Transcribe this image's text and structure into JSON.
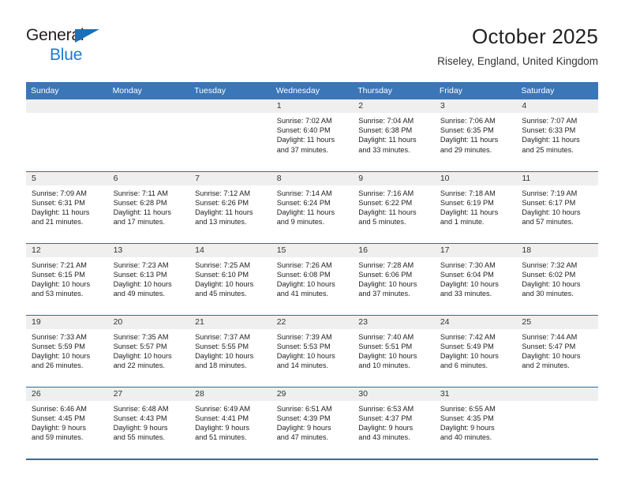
{
  "brand": {
    "line1": "General",
    "line2": "Blue",
    "triangle_color": "#1b70b8",
    "blue_text_color": "#1b7ad1"
  },
  "header": {
    "title": "October 2025",
    "subtitle": "Riseley, England, United Kingdom"
  },
  "theme": {
    "header_bg": "#3a76b8",
    "rule_color": "#2b6cab",
    "daynum_bg": "#efefef"
  },
  "weekday_headers": [
    "Sunday",
    "Monday",
    "Tuesday",
    "Wednesday",
    "Thursday",
    "Friday",
    "Saturday"
  ],
  "weeks": [
    [
      {
        "day": "",
        "empty": true,
        "sunrise": "",
        "sunset": "",
        "daylight_line1": "",
        "daylight_line2": ""
      },
      {
        "day": "",
        "empty": true,
        "sunrise": "",
        "sunset": "",
        "daylight_line1": "",
        "daylight_line2": ""
      },
      {
        "day": "",
        "empty": true,
        "sunrise": "",
        "sunset": "",
        "daylight_line1": "",
        "daylight_line2": ""
      },
      {
        "day": "1",
        "empty": false,
        "sunrise": "Sunrise: 7:02 AM",
        "sunset": "Sunset: 6:40 PM",
        "daylight_line1": "Daylight: 11 hours",
        "daylight_line2": "and 37 minutes."
      },
      {
        "day": "2",
        "empty": false,
        "sunrise": "Sunrise: 7:04 AM",
        "sunset": "Sunset: 6:38 PM",
        "daylight_line1": "Daylight: 11 hours",
        "daylight_line2": "and 33 minutes."
      },
      {
        "day": "3",
        "empty": false,
        "sunrise": "Sunrise: 7:06 AM",
        "sunset": "Sunset: 6:35 PM",
        "daylight_line1": "Daylight: 11 hours",
        "daylight_line2": "and 29 minutes."
      },
      {
        "day": "4",
        "empty": false,
        "sunrise": "Sunrise: 7:07 AM",
        "sunset": "Sunset: 6:33 PM",
        "daylight_line1": "Daylight: 11 hours",
        "daylight_line2": "and 25 minutes."
      }
    ],
    [
      {
        "day": "5",
        "empty": false,
        "sunrise": "Sunrise: 7:09 AM",
        "sunset": "Sunset: 6:31 PM",
        "daylight_line1": "Daylight: 11 hours",
        "daylight_line2": "and 21 minutes."
      },
      {
        "day": "6",
        "empty": false,
        "sunrise": "Sunrise: 7:11 AM",
        "sunset": "Sunset: 6:28 PM",
        "daylight_line1": "Daylight: 11 hours",
        "daylight_line2": "and 17 minutes."
      },
      {
        "day": "7",
        "empty": false,
        "sunrise": "Sunrise: 7:12 AM",
        "sunset": "Sunset: 6:26 PM",
        "daylight_line1": "Daylight: 11 hours",
        "daylight_line2": "and 13 minutes."
      },
      {
        "day": "8",
        "empty": false,
        "sunrise": "Sunrise: 7:14 AM",
        "sunset": "Sunset: 6:24 PM",
        "daylight_line1": "Daylight: 11 hours",
        "daylight_line2": "and 9 minutes."
      },
      {
        "day": "9",
        "empty": false,
        "sunrise": "Sunrise: 7:16 AM",
        "sunset": "Sunset: 6:22 PM",
        "daylight_line1": "Daylight: 11 hours",
        "daylight_line2": "and 5 minutes."
      },
      {
        "day": "10",
        "empty": false,
        "sunrise": "Sunrise: 7:18 AM",
        "sunset": "Sunset: 6:19 PM",
        "daylight_line1": "Daylight: 11 hours",
        "daylight_line2": "and 1 minute."
      },
      {
        "day": "11",
        "empty": false,
        "sunrise": "Sunrise: 7:19 AM",
        "sunset": "Sunset: 6:17 PM",
        "daylight_line1": "Daylight: 10 hours",
        "daylight_line2": "and 57 minutes."
      }
    ],
    [
      {
        "day": "12",
        "empty": false,
        "sunrise": "Sunrise: 7:21 AM",
        "sunset": "Sunset: 6:15 PM",
        "daylight_line1": "Daylight: 10 hours",
        "daylight_line2": "and 53 minutes."
      },
      {
        "day": "13",
        "empty": false,
        "sunrise": "Sunrise: 7:23 AM",
        "sunset": "Sunset: 6:13 PM",
        "daylight_line1": "Daylight: 10 hours",
        "daylight_line2": "and 49 minutes."
      },
      {
        "day": "14",
        "empty": false,
        "sunrise": "Sunrise: 7:25 AM",
        "sunset": "Sunset: 6:10 PM",
        "daylight_line1": "Daylight: 10 hours",
        "daylight_line2": "and 45 minutes."
      },
      {
        "day": "15",
        "empty": false,
        "sunrise": "Sunrise: 7:26 AM",
        "sunset": "Sunset: 6:08 PM",
        "daylight_line1": "Daylight: 10 hours",
        "daylight_line2": "and 41 minutes."
      },
      {
        "day": "16",
        "empty": false,
        "sunrise": "Sunrise: 7:28 AM",
        "sunset": "Sunset: 6:06 PM",
        "daylight_line1": "Daylight: 10 hours",
        "daylight_line2": "and 37 minutes."
      },
      {
        "day": "17",
        "empty": false,
        "sunrise": "Sunrise: 7:30 AM",
        "sunset": "Sunset: 6:04 PM",
        "daylight_line1": "Daylight: 10 hours",
        "daylight_line2": "and 33 minutes."
      },
      {
        "day": "18",
        "empty": false,
        "sunrise": "Sunrise: 7:32 AM",
        "sunset": "Sunset: 6:02 PM",
        "daylight_line1": "Daylight: 10 hours",
        "daylight_line2": "and 30 minutes."
      }
    ],
    [
      {
        "day": "19",
        "empty": false,
        "sunrise": "Sunrise: 7:33 AM",
        "sunset": "Sunset: 5:59 PM",
        "daylight_line1": "Daylight: 10 hours",
        "daylight_line2": "and 26 minutes."
      },
      {
        "day": "20",
        "empty": false,
        "sunrise": "Sunrise: 7:35 AM",
        "sunset": "Sunset: 5:57 PM",
        "daylight_line1": "Daylight: 10 hours",
        "daylight_line2": "and 22 minutes."
      },
      {
        "day": "21",
        "empty": false,
        "sunrise": "Sunrise: 7:37 AM",
        "sunset": "Sunset: 5:55 PM",
        "daylight_line1": "Daylight: 10 hours",
        "daylight_line2": "and 18 minutes."
      },
      {
        "day": "22",
        "empty": false,
        "sunrise": "Sunrise: 7:39 AM",
        "sunset": "Sunset: 5:53 PM",
        "daylight_line1": "Daylight: 10 hours",
        "daylight_line2": "and 14 minutes."
      },
      {
        "day": "23",
        "empty": false,
        "sunrise": "Sunrise: 7:40 AM",
        "sunset": "Sunset: 5:51 PM",
        "daylight_line1": "Daylight: 10 hours",
        "daylight_line2": "and 10 minutes."
      },
      {
        "day": "24",
        "empty": false,
        "sunrise": "Sunrise: 7:42 AM",
        "sunset": "Sunset: 5:49 PM",
        "daylight_line1": "Daylight: 10 hours",
        "daylight_line2": "and 6 minutes."
      },
      {
        "day": "25",
        "empty": false,
        "sunrise": "Sunrise: 7:44 AM",
        "sunset": "Sunset: 5:47 PM",
        "daylight_line1": "Daylight: 10 hours",
        "daylight_line2": "and 2 minutes."
      }
    ],
    [
      {
        "day": "26",
        "empty": false,
        "sunrise": "Sunrise: 6:46 AM",
        "sunset": "Sunset: 4:45 PM",
        "daylight_line1": "Daylight: 9 hours",
        "daylight_line2": "and 59 minutes."
      },
      {
        "day": "27",
        "empty": false,
        "sunrise": "Sunrise: 6:48 AM",
        "sunset": "Sunset: 4:43 PM",
        "daylight_line1": "Daylight: 9 hours",
        "daylight_line2": "and 55 minutes."
      },
      {
        "day": "28",
        "empty": false,
        "sunrise": "Sunrise: 6:49 AM",
        "sunset": "Sunset: 4:41 PM",
        "daylight_line1": "Daylight: 9 hours",
        "daylight_line2": "and 51 minutes."
      },
      {
        "day": "29",
        "empty": false,
        "sunrise": "Sunrise: 6:51 AM",
        "sunset": "Sunset: 4:39 PM",
        "daylight_line1": "Daylight: 9 hours",
        "daylight_line2": "and 47 minutes."
      },
      {
        "day": "30",
        "empty": false,
        "sunrise": "Sunrise: 6:53 AM",
        "sunset": "Sunset: 4:37 PM",
        "daylight_line1": "Daylight: 9 hours",
        "daylight_line2": "and 43 minutes."
      },
      {
        "day": "31",
        "empty": false,
        "sunrise": "Sunrise: 6:55 AM",
        "sunset": "Sunset: 4:35 PM",
        "daylight_line1": "Daylight: 9 hours",
        "daylight_line2": "and 40 minutes."
      },
      {
        "day": "",
        "empty": true,
        "sunrise": "",
        "sunset": "",
        "daylight_line1": "",
        "daylight_line2": ""
      }
    ]
  ]
}
